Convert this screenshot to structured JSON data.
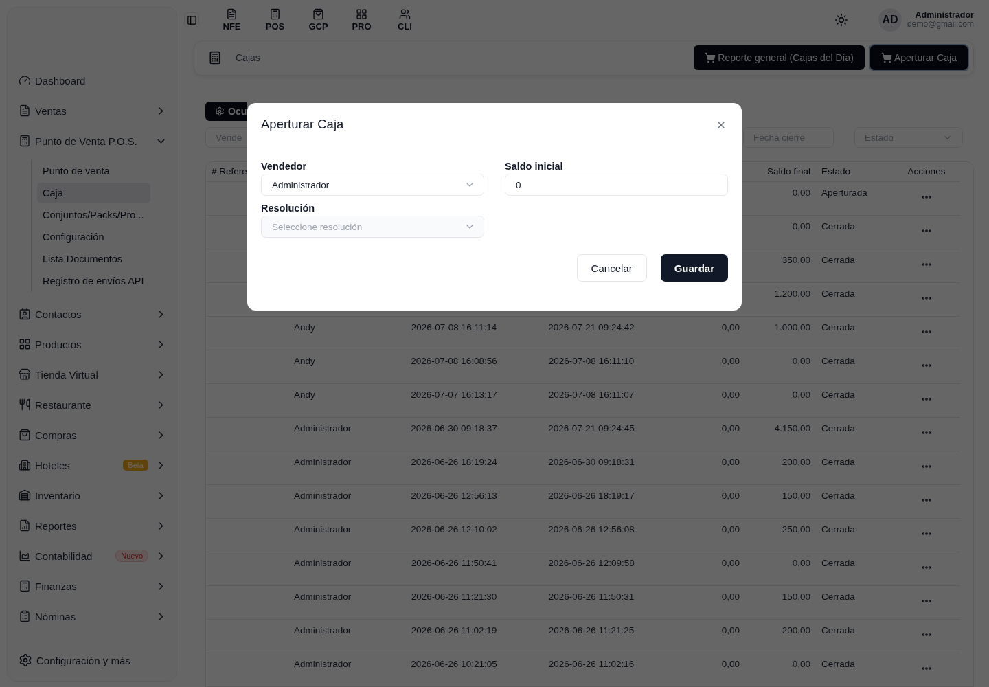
{
  "sidebar": {
    "items": [
      {
        "label": "Dashboard"
      },
      {
        "label": "Ventas",
        "expanded": false
      },
      {
        "label": "Punto de Venta P.O.S.",
        "expanded": true,
        "children": [
          {
            "label": "Punto de venta",
            "selected": false
          },
          {
            "label": "Caja",
            "selected": true
          },
          {
            "label": "Conjuntos/Packs/Pro...",
            "selected": false
          },
          {
            "label": "Configuración",
            "selected": false
          },
          {
            "label": "Lista Documentos",
            "selected": false
          },
          {
            "label": "Registro de envíos API",
            "selected": false
          }
        ]
      },
      {
        "label": "Contactos",
        "expanded": false
      },
      {
        "label": "Productos",
        "expanded": false
      },
      {
        "label": "Tienda Virtual",
        "expanded": false
      },
      {
        "label": "Restaurante",
        "expanded": false
      },
      {
        "label": "Compras",
        "expanded": false
      },
      {
        "label": "Hoteles",
        "expanded": false,
        "badge": {
          "label": "Beta",
          "kind": "beta"
        }
      },
      {
        "label": "Inventario",
        "expanded": false
      },
      {
        "label": "Reportes",
        "expanded": false
      },
      {
        "label": "Contabilidad",
        "expanded": false,
        "badge": {
          "label": "Nuevo",
          "kind": "new"
        }
      },
      {
        "label": "Finanzas",
        "expanded": false
      },
      {
        "label": "Nóminas",
        "expanded": false
      }
    ],
    "footer": "Configuración y más"
  },
  "topbar": {
    "nav": [
      "NFE",
      "POS",
      "GCP",
      "PRO",
      "CLI"
    ],
    "user": {
      "initials": "AD",
      "name": "Administrador",
      "email": "demo@gmail.com"
    }
  },
  "breadcrumb": {
    "title": "Cajas",
    "buttons": [
      {
        "label": "Reporte general (Cajas del Día)",
        "focused": false
      },
      {
        "label": "Aperturar Caja",
        "focused": true
      }
    ]
  },
  "filters": {
    "toggle": "Ocu",
    "vendedor_placeholder": "Vende",
    "fecha_cierre_placeholder": "Fecha cierre",
    "estado_placeholder": "Estado"
  },
  "table": {
    "columns": [
      "# Refere",
      "",
      "",
      "",
      "",
      "Saldo final",
      "Estado",
      "Acciones"
    ],
    "rows": [
      {
        "saldo_final": "0,00",
        "estado": "Aperturada"
      },
      {
        "saldo_final": "0,00",
        "estado": "Cerrada"
      },
      {
        "saldo_final": "350,00",
        "estado": "Cerrada"
      },
      {
        "saldo_final": "1.200,00",
        "estado": "Cerrada"
      },
      {
        "vendedor": "Andy",
        "apertura": "2026-07-08 16:11:14",
        "cierre": "2026-07-21 09:24:42",
        "saldo_inicial": "0,00",
        "saldo_final": "1.000,00",
        "estado": "Cerrada"
      },
      {
        "vendedor": "Andy",
        "apertura": "2026-07-08 16:08:56",
        "cierre": "2026-07-08 16:11:10",
        "saldo_inicial": "0,00",
        "saldo_final": "0,00",
        "estado": "Cerrada"
      },
      {
        "vendedor": "Andy",
        "apertura": "2026-07-07 16:13:17",
        "cierre": "2026-07-08 16:11:07",
        "saldo_inicial": "0,00",
        "saldo_final": "0,00",
        "estado": "Cerrada"
      },
      {
        "vendedor": "Administrador",
        "apertura": "2026-06-30 09:18:37",
        "cierre": "2026-07-21 09:24:45",
        "saldo_inicial": "0,00",
        "saldo_final": "4.150,00",
        "estado": "Cerrada"
      },
      {
        "vendedor": "Administrador",
        "apertura": "2026-06-26 18:19:24",
        "cierre": "2026-06-30 09:18:31",
        "saldo_inicial": "0,00",
        "saldo_final": "200,00",
        "estado": "Cerrada"
      },
      {
        "vendedor": "Administrador",
        "apertura": "2026-06-26 12:56:13",
        "cierre": "2026-06-26 18:19:17",
        "saldo_inicial": "0,00",
        "saldo_final": "150,00",
        "estado": "Cerrada"
      },
      {
        "vendedor": "Administrador",
        "apertura": "2026-06-26 12:10:02",
        "cierre": "2026-06-26 12:56:08",
        "saldo_inicial": "0,00",
        "saldo_final": "250,00",
        "estado": "Cerrada"
      },
      {
        "vendedor": "Administrador",
        "apertura": "2026-06-26 11:50:41",
        "cierre": "2026-06-26 12:09:58",
        "saldo_inicial": "0,00",
        "saldo_final": "0,00",
        "estado": "Cerrada"
      },
      {
        "vendedor": "Administrador",
        "apertura": "2026-06-26 11:21:30",
        "cierre": "2026-06-26 11:50:31",
        "saldo_inicial": "0,00",
        "saldo_final": "150,00",
        "estado": "Cerrada"
      },
      {
        "vendedor": "Administrador",
        "apertura": "2026-06-26 11:02:19",
        "cierre": "2026-06-26 11:21:25",
        "saldo_inicial": "0,00",
        "saldo_final": "200,00",
        "estado": "Cerrada"
      },
      {
        "vendedor": "Administrador",
        "apertura": "2026-06-26 10:21:05",
        "cierre": "2026-06-26 11:02:16",
        "saldo_inicial": "0,00",
        "saldo_final": "0,00",
        "estado": "Cerrada"
      }
    ]
  },
  "modal": {
    "title": "Aperturar Caja",
    "fields": [
      {
        "kind": "select",
        "label": "Vendedor",
        "value": "Administrador"
      },
      {
        "kind": "input",
        "label": "Saldo inicial",
        "value": "0"
      },
      {
        "kind": "select",
        "label": "Resolución",
        "placeholder": "Seleccione resolución",
        "disabled": true
      }
    ],
    "buttons": [
      {
        "label": "Cancelar",
        "kind": "secondary"
      },
      {
        "label": "Guardar",
        "kind": "primary"
      }
    ]
  }
}
